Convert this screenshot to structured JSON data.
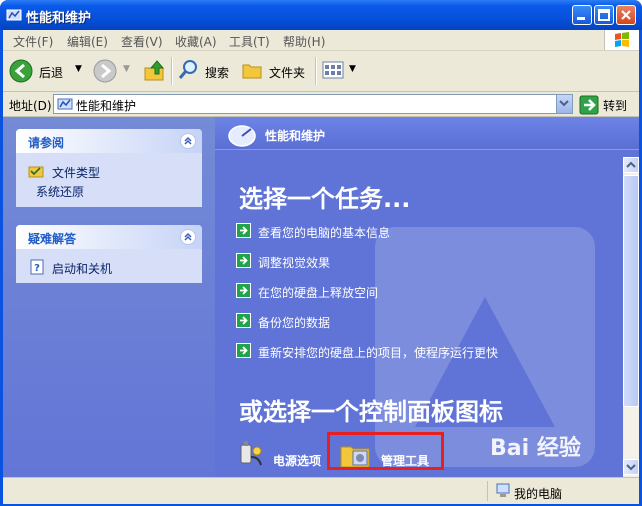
{
  "window": {
    "title": "性能和维护"
  },
  "menubar": {
    "items": [
      "文件(F)",
      "编辑(E)",
      "查看(V)",
      "收藏(A)",
      "工具(T)",
      "帮助(H)"
    ]
  },
  "toolbar": {
    "back_label": "后退",
    "search_label": "搜索",
    "folders_label": "文件夹"
  },
  "addressbar": {
    "label": "地址(D)",
    "value": "性能和维护",
    "go_label": "转到"
  },
  "leftpane": {
    "see_also": {
      "title": "请参阅",
      "items": [
        "文件类型",
        "系统还原"
      ]
    },
    "troubleshoot": {
      "title": "疑难解答",
      "items": [
        "启动和关机"
      ]
    }
  },
  "rightpane": {
    "header": "性能和维护",
    "task_heading": "选择一个任务...",
    "tasks": [
      "查看您的电脑的基本信息",
      "调整视觉效果",
      "在您的硬盘上释放空间",
      "备份您的数据",
      "重新安排您的硬盘上的项目，使程序运行更快"
    ],
    "cp_heading": "或选择一个控制面板图标",
    "icons": [
      {
        "label": "电源选项",
        "icon": "power-options-icon"
      },
      {
        "label": "管理工具",
        "icon": "admin-tools-icon"
      }
    ]
  },
  "statusbar": {
    "location": "我的电脑"
  },
  "watermark": {
    "text": "Bai 经验"
  },
  "colors": {
    "title_blue": "#0651dc",
    "pane_blue": "#5f74d6",
    "highlight_red": "#e81f1f",
    "task_arrow_green": "#22a34b"
  }
}
